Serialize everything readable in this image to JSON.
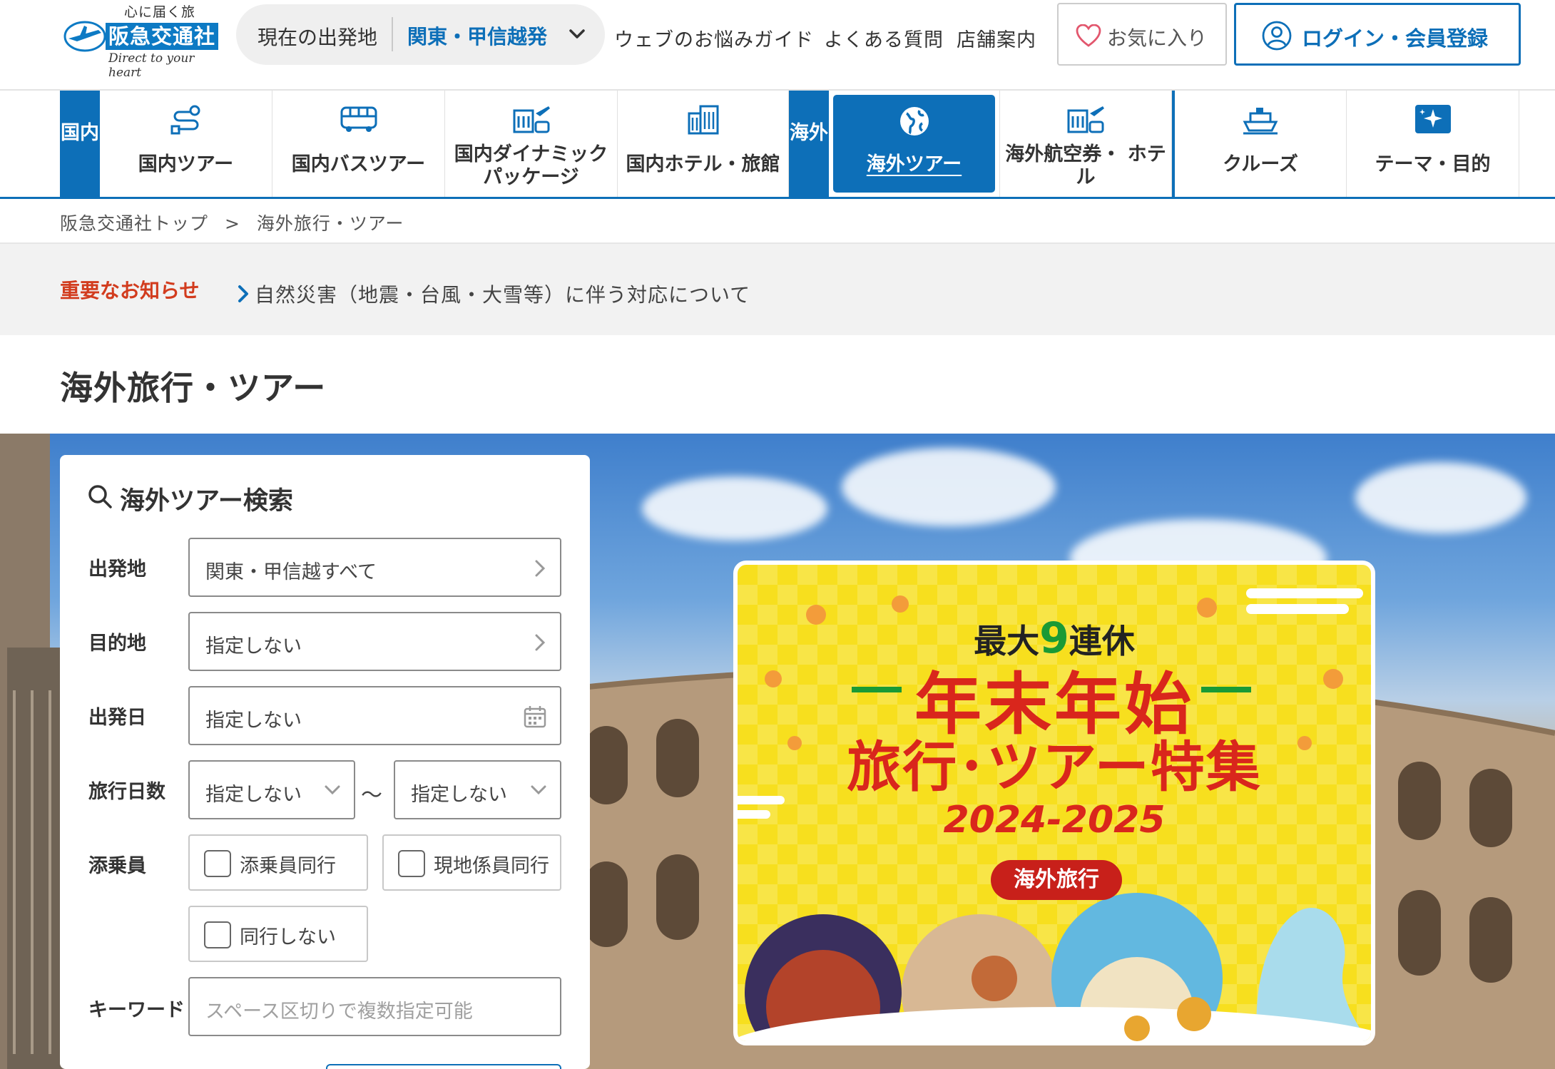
{
  "brand": {
    "tagline": "心に届く旅",
    "name": "阪急交通社",
    "subline": "Direct to your heart"
  },
  "departure": {
    "label": "現在の出発地",
    "value": "関東・甲信越発"
  },
  "header_links": [
    "ウェブのお悩みガイド",
    "よくある質問",
    "店舗案内"
  ],
  "favorites": {
    "label": "お気に入り"
  },
  "login": {
    "label": "ログイン・会員登録"
  },
  "category_nav": {
    "domestic_tag": "国内",
    "overseas_tag": "海外",
    "domestic": [
      {
        "label": "国内ツアー",
        "icon": "route-icon"
      },
      {
        "label": "国内バスツアー",
        "icon": "bus-icon"
      },
      {
        "label": "国内ダイナミック パッケージ",
        "icon": "hotel-plane-icon"
      },
      {
        "label": "国内ホテル・旅館",
        "icon": "building-icon"
      }
    ],
    "overseas": [
      {
        "label": "海外ツアー",
        "icon": "globe-icon",
        "active": true
      },
      {
        "label": "海外航空券・ ホテル",
        "icon": "hotel-plane-icon"
      },
      {
        "label": "クルーズ",
        "icon": "ship-icon"
      },
      {
        "label": "テーマ・目的",
        "icon": "sparkle-icon"
      }
    ]
  },
  "breadcrumb": [
    "阪急交通社トップ",
    ">",
    "海外旅行・ツアー"
  ],
  "notice": {
    "title": "重要なお知らせ",
    "link": "自然災害（地震・台風・大雪等）に伴う対応について"
  },
  "page_title": "海外旅行・ツアー",
  "search": {
    "title": "海外ツアー検索",
    "fields": {
      "departure": {
        "label": "出発地",
        "value": "関東・甲信越すべて"
      },
      "destination": {
        "label": "目的地",
        "value": "指定しない"
      },
      "date": {
        "label": "出発日",
        "value": "指定しない"
      },
      "days": {
        "label": "旅行日数",
        "from": "指定しない",
        "separator": "〜",
        "to": "指定しない"
      },
      "conductor": {
        "label": "添乗員",
        "options": [
          "添乗員同行",
          "現地係員同行",
          "同行しない"
        ]
      },
      "keyword": {
        "label": "キーワード",
        "placeholder": "スペース区切りで複数指定可能"
      }
    }
  },
  "banner": {
    "top_prefix": "最大",
    "top_number": "9",
    "top_suffix": "連休",
    "line1": "年末年始",
    "line2": "旅行･ツアー特集",
    "years": "2024-2025",
    "badge": "海外旅行"
  },
  "colors": {
    "brand_blue": "#0d6fb8",
    "notice_red": "#d23c1e",
    "banner_yellow": "#f7df1e",
    "banner_red": "#d9261c"
  }
}
